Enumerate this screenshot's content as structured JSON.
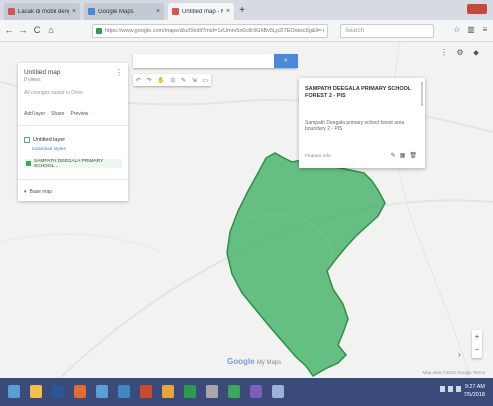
{
  "browser": {
    "tabs": [
      {
        "title": "Lacak di mobil dengan Peta",
        "favicon_color": "#d9534f",
        "active": false
      },
      {
        "title": "Google Maps",
        "favicon_color": "#4a89dc",
        "active": false
      },
      {
        "title": "Untitled map - My Maps",
        "favicon_color": "#d9534f",
        "active": true
      }
    ],
    "new_tab_label": "+",
    "url": "https://www.google.com/maps/d/u/0/edit?mid=1zUmrv5n0c8r9GhBv5Lp2I7EOskxc6g&ll=-6.84",
    "search_placeholder": "Search",
    "nav": {
      "back": "←",
      "forward": "→",
      "reload": "C",
      "home": "⌂"
    }
  },
  "map_panel": {
    "title": "Untitled map",
    "subtitle": "0 views",
    "meta": "All changes saved in Drive",
    "actions": [
      "Add layer",
      "Share",
      "Preview"
    ],
    "layer_name": "Untitled layer",
    "layer_link": "Individual styles",
    "layer_item": "SAMPATH DEEGALA PRIMARY SCHOOL...",
    "base_map": "Base map"
  },
  "map_search": {
    "button": "⌕",
    "tools": [
      "↶",
      "↷",
      "✋",
      "⊙",
      "✎",
      "⇲",
      "▭"
    ]
  },
  "info_card": {
    "title": "SAMPATH DEEGALA PRIMARY SCHOOL FOREST 2 - PIS",
    "description": "Sampath Deegala primary school forest area boundary 2 - PIS",
    "footer": "Feature info",
    "actions": [
      "✎",
      "▦",
      "🗑"
    ]
  },
  "map_corner_icons": [
    "⋮",
    "⚙",
    "⬥"
  ],
  "watermark": {
    "logo": "Google",
    "sub": "My Maps"
  },
  "zoom": {
    "in": "+",
    "out": "−"
  },
  "attribution": "Map data ©2018 Google  Terms",
  "polygon": {
    "fill": "#4cb56e",
    "stroke": "#2e8f4a"
  },
  "taskbar": {
    "icons": [
      "start",
      "explorer",
      "word",
      "firefox",
      "files",
      "chrome",
      "media",
      "store",
      "excel",
      "settings",
      "photos",
      "notes",
      "paint"
    ],
    "icon_colors": [
      "#5a9fd4",
      "#f0c04a",
      "#2b5797",
      "#e66a2c",
      "#5aa0d8",
      "#3e86c6",
      "#d04a2a",
      "#e8a33d",
      "#2c9b4a",
      "#a8a8a8",
      "#3aa857",
      "#7c5fb8",
      "#9ab4d8"
    ],
    "time": "9:27 AM",
    "date": "7/5/2018"
  }
}
